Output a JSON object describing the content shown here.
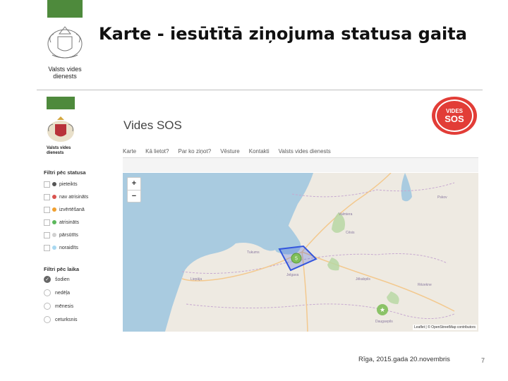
{
  "slide": {
    "title": "Karte - iesūtītā ziņojuma statusa gaita",
    "org_name_line1": "Valsts vides",
    "org_name_line2": "dienests",
    "footer_date": "Rīga, 2015.gada 20.novembris",
    "page_number": "7"
  },
  "app": {
    "title": "Vides SOS",
    "logo_line1": "VIDES",
    "logo_line2": "SOS",
    "org_name_line1": "Valsts vides",
    "org_name_line2": "dienests",
    "nav": [
      "Karte",
      "Kā lietot?",
      "Par ko ziņot?",
      "Vēsture",
      "Kontakti",
      "Valsts vides dienests"
    ]
  },
  "filters": {
    "status_title": "Filtri pēc statusa",
    "status_items": [
      {
        "label": "pieteikts",
        "color": "#555555"
      },
      {
        "label": "nav atrisināts",
        "color": "#d9534f"
      },
      {
        "label": "izvērtēšanā",
        "color": "#f0a030"
      },
      {
        "label": "atrisināts",
        "color": "#5cb85c"
      },
      {
        "label": "pārsūtīts",
        "color": "#d0d0d0"
      },
      {
        "label": "noraidīts",
        "color": "#a8d8f0"
      }
    ],
    "time_title": "Filtri pēc laika",
    "time_items": [
      {
        "label": "šodien",
        "selected": true
      },
      {
        "label": "nedēļa",
        "selected": false
      },
      {
        "label": "mēnesis",
        "selected": false
      },
      {
        "label": "ceturksnis",
        "selected": false
      }
    ]
  },
  "map": {
    "zoom_in": "+",
    "zoom_out": "−",
    "cluster_count": "5",
    "attribution": "Leaflet | © OpenStreetMap contributors",
    "labels": [
      "Pskov",
      "Jelgava",
      "Jēkabpils",
      "Liepāja",
      "Daugavpils",
      "Cēsis",
      "Valmiera",
      "Tukums",
      "Rēzekne"
    ],
    "colors": {
      "sea": "#a9cbe0",
      "land": "#eeeae2",
      "selection": "#3355dd",
      "cluster": "#7fbf5a"
    }
  }
}
